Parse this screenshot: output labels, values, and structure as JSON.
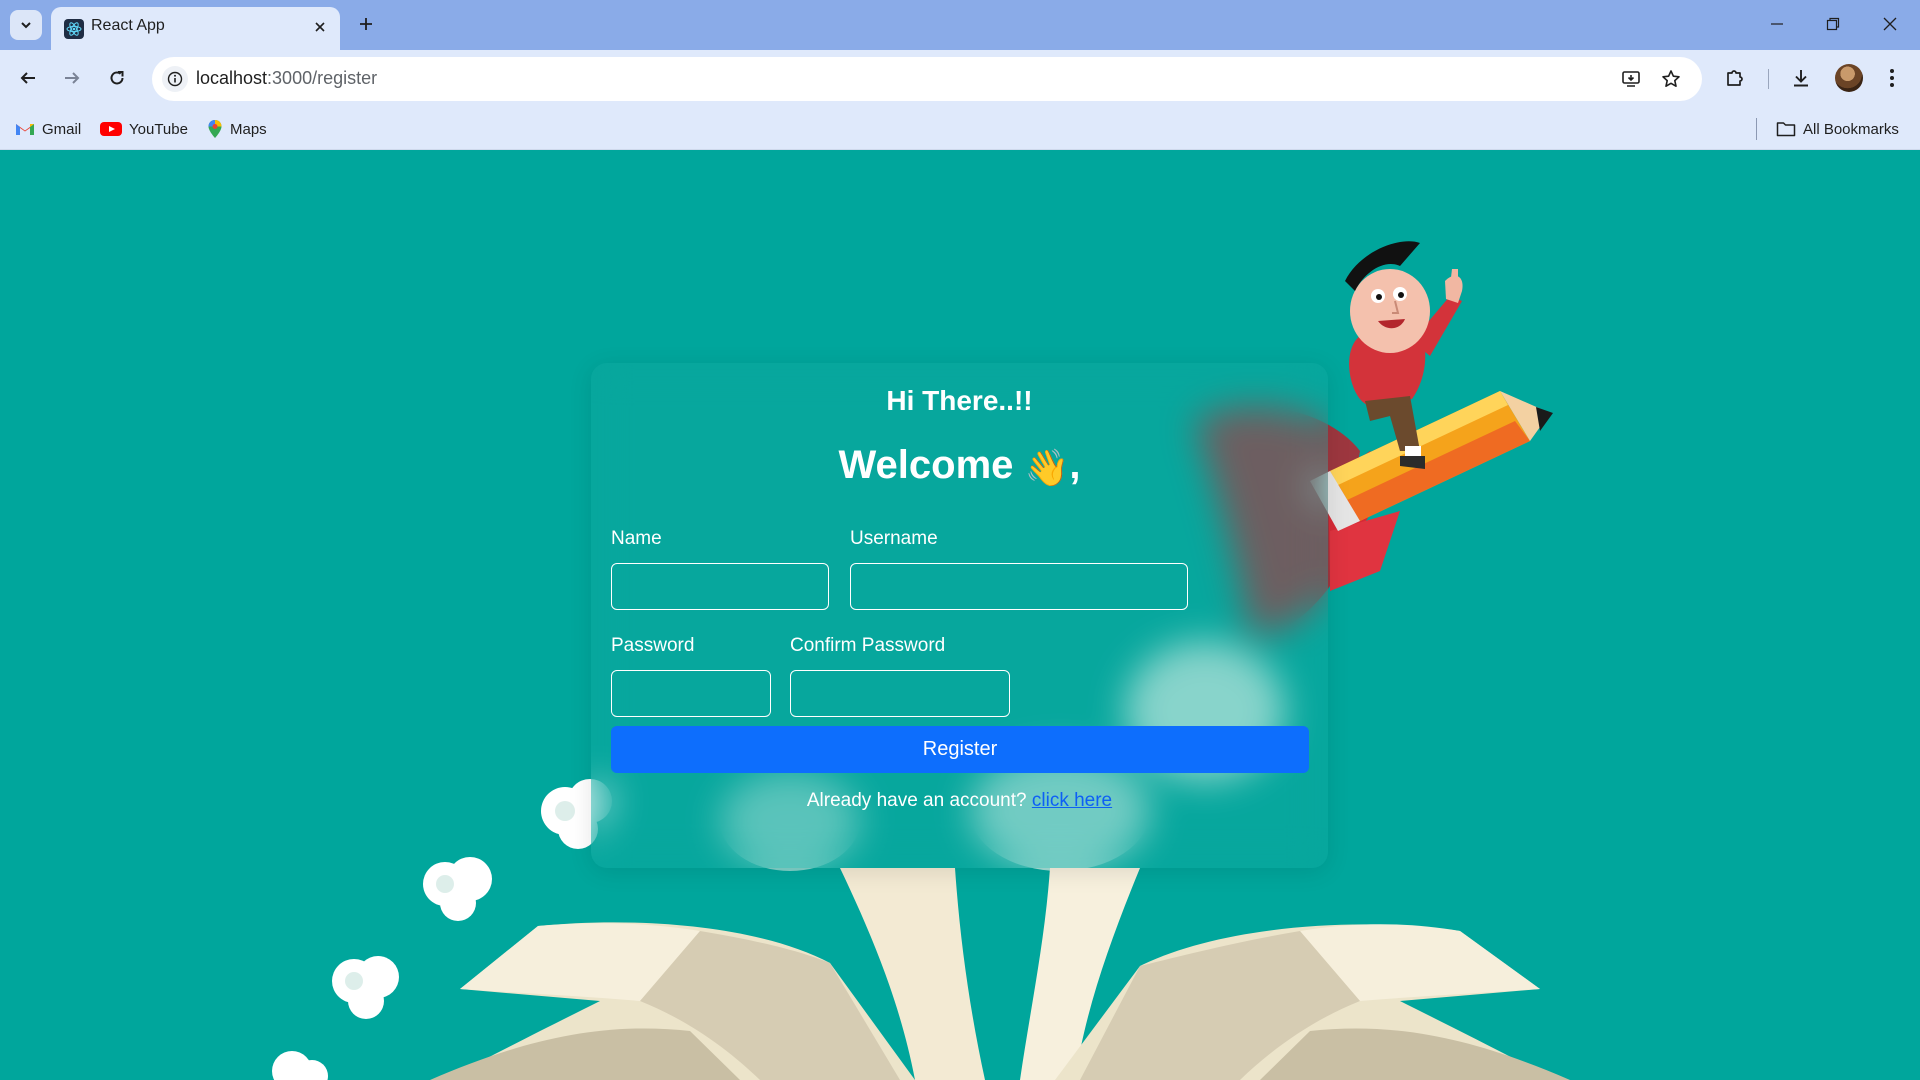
{
  "browser": {
    "tab_title": "React App",
    "url_host": "localhost",
    "url_path": ":3000/register",
    "bookmarks": [
      {
        "label": "Gmail",
        "icon": "gmail-icon"
      },
      {
        "label": "YouTube",
        "icon": "youtube-icon"
      },
      {
        "label": "Maps",
        "icon": "maps-icon"
      }
    ],
    "all_bookmarks": "All Bookmarks"
  },
  "form": {
    "greeting": "Hi There..!!",
    "welcome": "Welcome",
    "wave_emoji": "👋",
    "welcome_suffix": ",",
    "name_label": "Name",
    "username_label": "Username",
    "password_label": "Password",
    "confirm_label": "Confirm Password",
    "name_value": "",
    "username_value": "",
    "password_value": "",
    "confirm_value": "",
    "register_label": "Register",
    "login_prompt": "Already have an account?",
    "login_link": "click here"
  },
  "colors": {
    "page_bg": "#00a69c",
    "button": "#0d6efd",
    "browser_frame": "#8aabe8",
    "toolbar": "#dfe9fb"
  }
}
